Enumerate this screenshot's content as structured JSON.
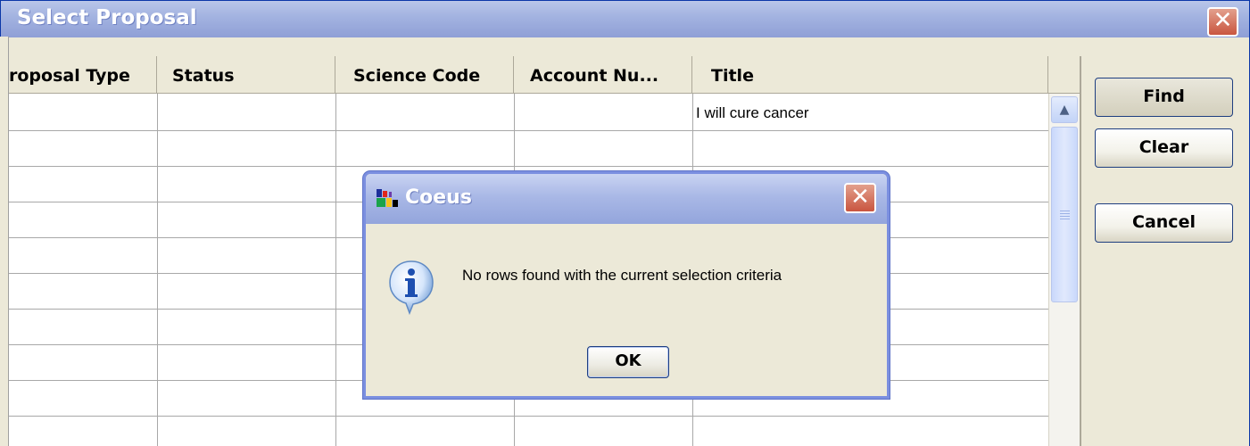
{
  "window": {
    "title": "Select Proposal",
    "close_glyph": "✕"
  },
  "table": {
    "columns": [
      "roposal Type",
      "Status",
      "Science Code",
      "Account Nu...",
      "Title"
    ],
    "rows": [
      [
        "",
        "",
        "",
        "",
        "I will cure cancer"
      ]
    ]
  },
  "scrollbar": {
    "up_glyph": "▲"
  },
  "buttons": {
    "find": "Find",
    "clear": "Clear",
    "cancel": "Cancel"
  },
  "dialog": {
    "title": "Coeus",
    "close_glyph": "✕",
    "message": "No rows found with the current selection criteria",
    "ok": "OK",
    "icon": "info-icon"
  },
  "colors": {
    "titlebar": "#a4b4e1",
    "close_button": "#c9553f",
    "face": "#ece9d8"
  }
}
